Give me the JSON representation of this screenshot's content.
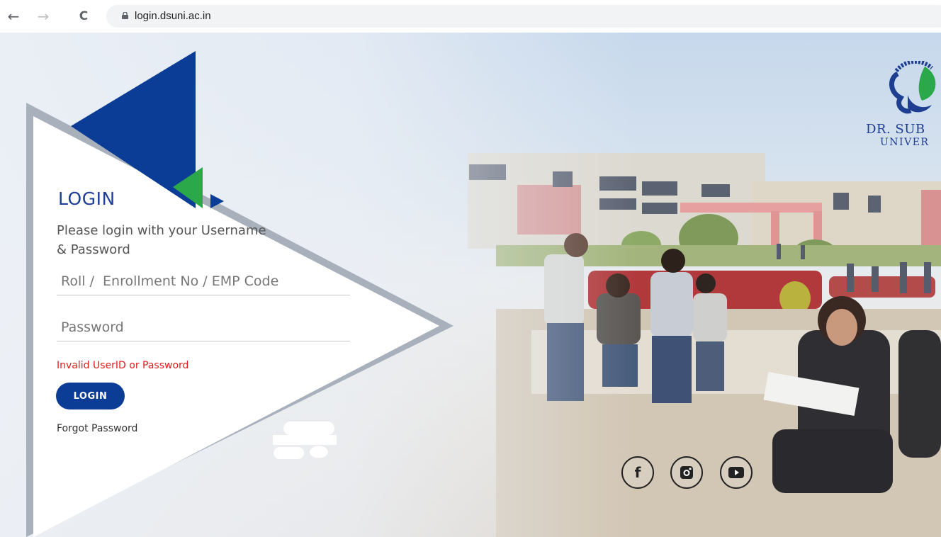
{
  "browser": {
    "url": "login.dsuni.ac.in",
    "back_icon": "←",
    "forward_icon": "→",
    "reload_icon": "C"
  },
  "login": {
    "title": "LOGIN",
    "subtitle": "Please login with your Username & Password",
    "username_placeholder": "Roll /  Enrollment No / EMP Code",
    "username_value": "",
    "password_placeholder": "Password",
    "password_value": "",
    "error_message": "Invalid UserID or Password",
    "button_label": "LOGIN",
    "forgot_label": "Forgot Password"
  },
  "logo": {
    "line1": "DR. SUB",
    "line2": "UNIVER"
  },
  "social": {
    "facebook_glyph": "f",
    "icons": [
      "facebook-icon",
      "instagram-icon",
      "youtube-icon"
    ]
  },
  "colors": {
    "primary_blue": "#0c3d96",
    "title_blue": "#1f3f97",
    "error_red": "#e21b1b",
    "accent_green": "#2aa84a",
    "panel_border": "#a8b0bb"
  }
}
